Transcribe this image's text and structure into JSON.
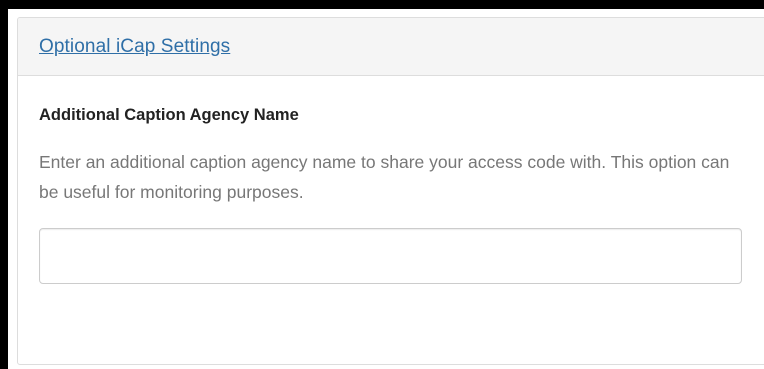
{
  "panel": {
    "title": "Optional iCap Settings"
  },
  "field": {
    "label": "Additional Caption Agency Name",
    "help_text": "Enter an additional caption agency name to share your access code with. This option can be useful for monitoring purposes.",
    "value": "",
    "placeholder": ""
  },
  "colors": {
    "link": "#2f6fa7",
    "heading_bg": "#f5f5f5",
    "border": "#dddddd",
    "help_text": "#777777"
  }
}
